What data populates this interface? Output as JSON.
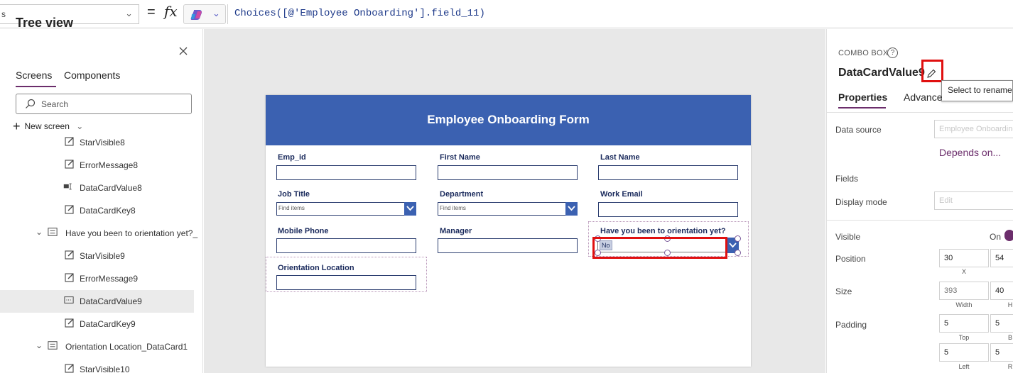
{
  "formula_bar": {
    "property_dropdown_text": "s",
    "equals": "=",
    "fx": "fx",
    "formula": "Choices([@'Employee Onboarding'].field_11)"
  },
  "tree_view": {
    "title": "Tree view",
    "tabs": {
      "screens": "Screens",
      "components": "Components"
    },
    "search_placeholder": "Search",
    "new_screen": "New screen",
    "items": [
      {
        "label": "StarVisible8",
        "icon": "edit-icon"
      },
      {
        "label": "ErrorMessage8",
        "icon": "edit-icon"
      },
      {
        "label": "DataCardValue8",
        "icon": "text-input-icon"
      },
      {
        "label": "DataCardKey8",
        "icon": "edit-icon"
      },
      {
        "label": "Have you been to orientation yet?_",
        "icon": "card-icon"
      },
      {
        "label": "StarVisible9",
        "icon": "edit-icon"
      },
      {
        "label": "ErrorMessage9",
        "icon": "edit-icon"
      },
      {
        "label": "DataCardValue9",
        "icon": "combo-box-icon"
      },
      {
        "label": "DataCardKey9",
        "icon": "edit-icon"
      },
      {
        "label": "Orientation Location_DataCard1",
        "icon": "card-icon"
      },
      {
        "label": "StarVisible10",
        "icon": "edit-icon"
      }
    ]
  },
  "form": {
    "title": "Employee Onboarding Form",
    "fields": {
      "emp_id": "Emp_id",
      "first_name": "First Name",
      "last_name": "Last Name",
      "job_title": "Job Title",
      "department": "Department",
      "work_email": "Work Email",
      "mobile_phone": "Mobile Phone",
      "manager": "Manager",
      "orientation": "Have you been to orientation yet?",
      "orientation_location": "Orientation Location"
    },
    "combo_placeholder": "Find items",
    "orientation_value": "No"
  },
  "properties": {
    "control_type": "COMBO BOX",
    "control_name": "DataCardValue9",
    "tooltip": "Select to rename",
    "tabs": {
      "properties": "Properties",
      "advanced": "Advanced"
    },
    "data_source_label": "Data source",
    "data_source_value": "Employee Onboarding",
    "depends_on": "Depends on...",
    "fields_label": "Fields",
    "display_mode_label": "Display mode",
    "display_mode_value": "Edit",
    "visible_label": "Visible",
    "visible_value": "On",
    "position_label": "Position",
    "position_x": "30",
    "position_y": "54",
    "position_x_caption": "X",
    "size_label": "Size",
    "size_width": "393",
    "size_height": "40",
    "size_width_caption": "Width",
    "size_height_caption": "H",
    "padding_label": "Padding",
    "padding_top": "5",
    "padding_bottom": "5",
    "padding_top_caption": "Top",
    "padding_bottom_caption": "B",
    "padding_left": "5",
    "padding_right": "5",
    "padding_left_caption": "Left",
    "padding_right_caption": "R"
  },
  "colors": {
    "form_header": "#3b61b1",
    "accent": "#6b2d6b",
    "highlight": "#e01010"
  }
}
